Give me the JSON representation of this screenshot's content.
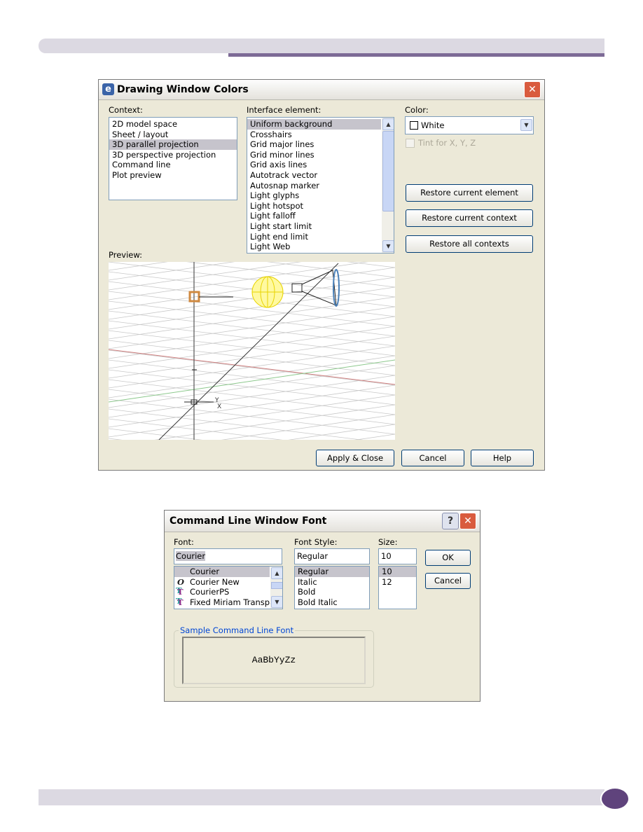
{
  "page": {
    "accent_color": "#7d6a96",
    "page_dot_color": "#5f437c",
    "bar_color": "#dcd9e2"
  },
  "drawing_dialog": {
    "title": "Drawing Window Colors",
    "app_icon": "e-logo-icon",
    "context_label": "Context:",
    "context_items": [
      "2D model space",
      "Sheet / layout",
      "3D parallel projection",
      "3D perspective projection",
      "Command line",
      "Plot preview"
    ],
    "context_selected": "3D parallel projection",
    "interface_label": "Interface element:",
    "interface_items": [
      "Uniform background",
      "Crosshairs",
      "Grid major lines",
      "Grid minor lines",
      "Grid axis lines",
      "Autotrack vector",
      "Autosnap marker",
      "Light glyphs",
      "Light hotspot",
      "Light falloff",
      "Light start limit",
      "Light end limit",
      "Light Web"
    ],
    "interface_selected": "Uniform background",
    "color_label": "Color:",
    "color_value": "White",
    "tint_label": "Tint for X, Y, Z",
    "tint_checked": false,
    "restore_element": "Restore current element",
    "restore_context": "Restore current context",
    "restore_all": "Restore all contexts",
    "preview_label": "Preview:",
    "preview_axis_labels": {
      "y": "Y",
      "x": "X"
    },
    "apply_close": "Apply & Close",
    "cancel": "Cancel",
    "help": "Help"
  },
  "font_dialog": {
    "title": "Command Line Window Font",
    "help_button": "?",
    "font_label": "Font:",
    "font_value": "Courier",
    "font_items": [
      {
        "name": "Courier",
        "icon": ""
      },
      {
        "name": "Courier New",
        "icon": "opentype-icon"
      },
      {
        "name": "CourierPS",
        "icon": "truetype-icon"
      },
      {
        "name": "Fixed Miriam Transpa",
        "icon": "truetype-icon"
      }
    ],
    "style_label": "Font Style:",
    "style_value": "Regular",
    "style_items": [
      "Regular",
      "Italic",
      "Bold",
      "Bold Italic"
    ],
    "size_label": "Size:",
    "size_value": "10",
    "size_items": [
      "10",
      "12"
    ],
    "ok": "OK",
    "cancel": "Cancel",
    "sample_label": "Sample Command Line Font",
    "sample_text": "AaBbYyZz"
  }
}
